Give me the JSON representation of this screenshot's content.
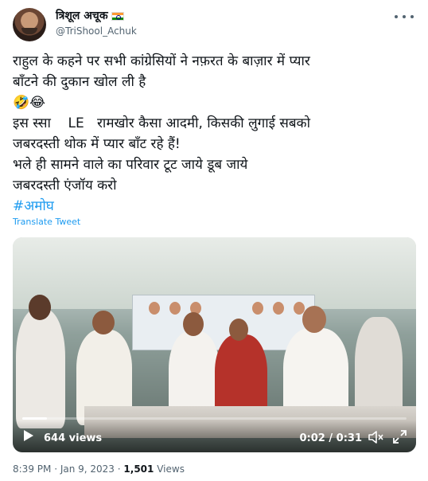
{
  "author": {
    "display_name": "त्रिशूल अचूक",
    "handle": "@TriShool_Achuk",
    "flag_icon": "india-flag-icon"
  },
  "tweet": {
    "lines": [
      "राहुल के कहने पर सभी कांग्रेसियों ने नफ़रत के बाज़ार में प्यार",
      "बाँटने की दुकान खोल ली है",
      "🤣😂",
      "इस स्सा    LE   रामखोर कैसा आदमी, किसकी लुगाई सबको",
      "जबरदस्ती थोक में प्यार बाँट रहे हैं!",
      "भले ही सामने वाले का परिवार टूट जाये डूब जाये",
      "जबरदस्ती एंजॉय करो"
    ],
    "hashtag": "#अमोघ",
    "translate_label": "Translate Tweet"
  },
  "video": {
    "views": "644 views",
    "time": "0:02 / 0:31",
    "progress": 0.065
  },
  "meta": {
    "time": "8:39 PM",
    "date": "Jan 9, 2023",
    "views_count": "1,501",
    "views_label": "Views"
  },
  "colors": {
    "link": "#1d9bf0",
    "secondary_text": "#536471",
    "primary_text": "#0f1419"
  }
}
